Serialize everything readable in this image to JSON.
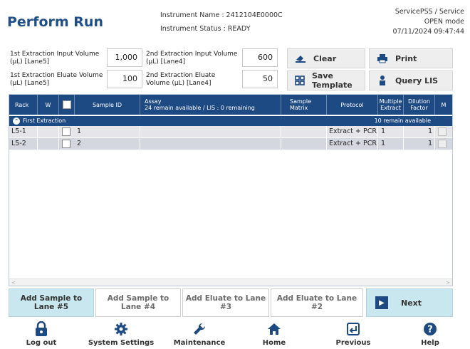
{
  "header": {
    "title": "Perform Run",
    "instrument_name": "Instrument Name : 2412104E0000C",
    "instrument_status": "Instrument Status : READY",
    "user": "ServicePSS / Service",
    "mode": "OPEN mode",
    "datetime": "07/11/2024 09:47:44"
  },
  "params": {
    "ext1_input_label": "1st Extraction Input Volume (µL) [Lane5]",
    "ext1_input_value": "1,000",
    "ext1_eluate_label": "1st Extraction Eluate Volume (µL) [Lane5]",
    "ext1_eluate_value": "100",
    "ext2_input_label": "2nd Extraction Input Volume (µL) [Lane4]",
    "ext2_input_value": "600",
    "ext2_eluate_label": "2nd Extraction Eluate Volume (µL) [Lane4]",
    "ext2_eluate_value": "50"
  },
  "actions": {
    "clear": "Clear",
    "print": "Print",
    "save_template": "Save Template",
    "query_lis": "Query LIS"
  },
  "table": {
    "headers": {
      "rack": "Rack",
      "w": "W",
      "sample_id": "Sample ID",
      "assay": "Assay",
      "assay_sub": "24 remain available / LIS : 0 remaining",
      "sample_matrix": "Sample Matrix",
      "protocol": "Protocol",
      "multiple_extract": "Multiple Extract",
      "dilution_factor": "Dilution Factor",
      "m": "M"
    },
    "group": {
      "label": "First Extraction",
      "available": "10 remain available"
    },
    "rows": [
      {
        "rack": "L5-1",
        "sample_id": "1",
        "protocol": "Extract + PCR",
        "multiple_extract": "1",
        "dilution_factor": "1"
      },
      {
        "rack": "L5-2",
        "sample_id": "2",
        "protocol": "Extract + PCR",
        "multiple_extract": "1",
        "dilution_factor": "1"
      }
    ]
  },
  "lanes": {
    "lane5": "Add Sample to Lane #5",
    "lane4": "Add Sample to Lane #4",
    "lane3": "Add Eluate to Lane #3",
    "lane2": "Add Eluate to Lane #2",
    "next": "Next"
  },
  "nav": {
    "logout": "Log out",
    "system_settings": "System Settings",
    "maintenance": "Maintenance",
    "home": "Home",
    "previous": "Previous",
    "help": "Help"
  },
  "colors": {
    "title": "#1f4f86",
    "table_header": "#1e4a84",
    "active_button": "#c9e7ee"
  },
  "icons": {
    "clear": "eraser-icon",
    "print": "printer-icon",
    "save_template": "grid-icon",
    "query_lis": "person-icon",
    "logout": "lock-icon",
    "system_settings": "gear-icon",
    "maintenance": "wrench-icon",
    "home": "home-icon",
    "previous": "return-icon",
    "help": "help-icon",
    "next": "arrow-right-icon"
  }
}
